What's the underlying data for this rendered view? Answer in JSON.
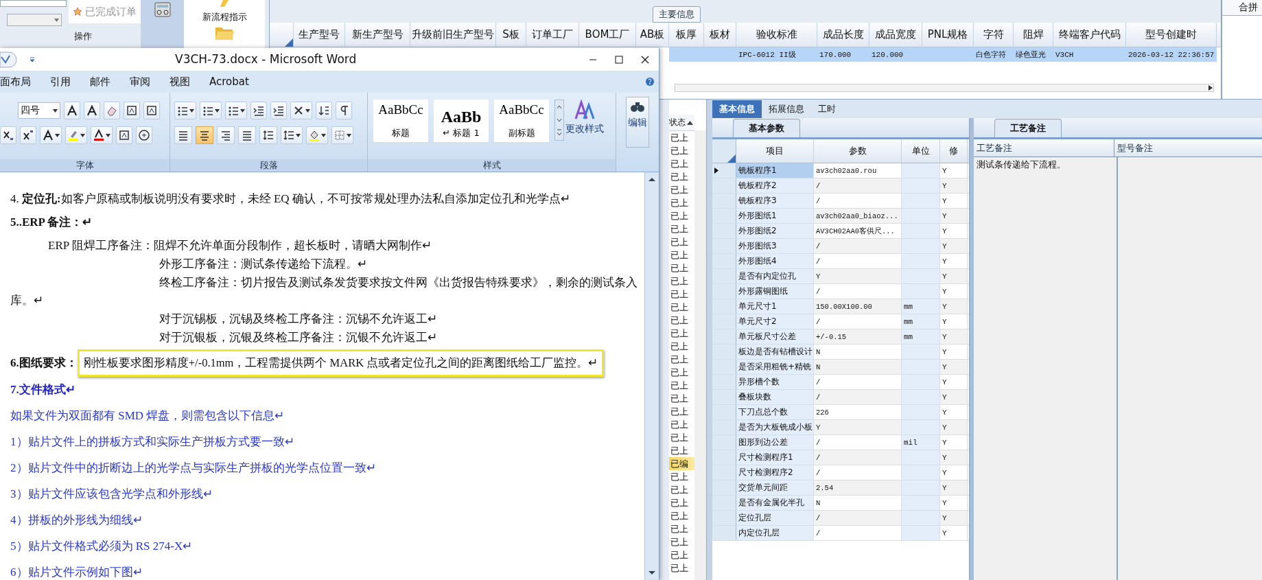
{
  "erp": {
    "left_tab": "已完成订单",
    "operations_label": "操作",
    "toolbar_button": "新流程指示",
    "main_grid": {
      "group_label": "主要信息",
      "columns": [
        "生产型号",
        "新生产型号",
        "升级前旧生产型号",
        "S板",
        "订单工厂",
        "BOM工厂",
        "AB板",
        "板厚",
        "板材",
        "验收标准",
        "成品长度",
        "成品宽度",
        "PNL规格",
        "字符",
        "阻焊",
        "终端客户代码",
        "型号创建时"
      ],
      "rows": [
        {
          "selected": true,
          "cells": [
            null,
            null,
            null,
            null,
            null,
            null,
            null,
            null,
            null,
            "IPC-6012 II级",
            "170.000",
            "120.000",
            null,
            "白色字符",
            "绿色亚光",
            "V3CH",
            "2026-03-12 22:36:57"
          ]
        }
      ]
    },
    "merge_panel": {
      "title": "合拼"
    },
    "status_list": {
      "header": "状态",
      "rows": [
        {
          "text": "已上",
          "selected": false
        },
        {
          "text": "已上",
          "selected": false
        },
        {
          "text": "已上",
          "selected": false
        },
        {
          "text": "已上",
          "selected": false
        },
        {
          "text": "已上",
          "selected": false
        },
        {
          "text": "已上",
          "selected": false
        },
        {
          "text": "已上",
          "selected": false
        },
        {
          "text": "已上",
          "selected": false
        },
        {
          "text": "已上",
          "selected": false
        },
        {
          "text": "已上",
          "selected": false
        },
        {
          "text": "已上",
          "selected": false
        },
        {
          "text": "已上",
          "selected": false
        },
        {
          "text": "已上",
          "selected": false
        },
        {
          "text": "已上",
          "selected": false
        },
        {
          "text": "已上",
          "selected": false
        },
        {
          "text": "已上",
          "selected": false
        },
        {
          "text": "已上",
          "selected": false
        },
        {
          "text": "已上",
          "selected": false
        },
        {
          "text": "已上",
          "selected": false
        },
        {
          "text": "已上",
          "selected": false
        },
        {
          "text": "已上",
          "selected": false
        },
        {
          "text": "已上",
          "selected": false
        },
        {
          "text": "已上",
          "selected": false
        },
        {
          "text": "已上",
          "selected": false
        },
        {
          "text": "已上",
          "selected": false
        },
        {
          "text": "已编",
          "selected": true
        },
        {
          "text": "已上",
          "selected": false
        },
        {
          "text": "已上",
          "selected": false
        },
        {
          "text": "已上",
          "selected": false
        },
        {
          "text": "已上",
          "selected": false
        },
        {
          "text": "已上",
          "selected": false
        },
        {
          "text": "已上",
          "selected": false
        },
        {
          "text": "已上",
          "selected": false
        },
        {
          "text": "已上",
          "selected": false
        }
      ]
    },
    "detail_tabs": [
      {
        "label": "基本信息",
        "selected": true
      },
      {
        "label": "拓展信息",
        "selected": false
      },
      {
        "label": "工时",
        "selected": false
      }
    ],
    "params_panel": {
      "tab": "基本参数",
      "columns": [
        "项目",
        "参数",
        "单位",
        "修"
      ],
      "rows": [
        {
          "item": "铣板程序1",
          "value": "av3ch02aa0.rou",
          "modified": "Y",
          "selected": true
        },
        {
          "item": "铣板程序2",
          "value": "/",
          "modified": "Y",
          "selected": false
        },
        {
          "item": "铣板程序3",
          "value": "/",
          "modified": "Y",
          "selected": false
        },
        {
          "item": "外形图纸1",
          "value": "av3ch02aa0_biaoz...",
          "modified": "Y",
          "selected": false
        },
        {
          "item": "外形图纸2",
          "value": "AV3CH02AA0客供尺...",
          "modified": "Y",
          "selected": false
        },
        {
          "item": "外形图纸3",
          "value": "/",
          "modified": "Y",
          "selected": false
        },
        {
          "item": "外形图纸4",
          "value": "/",
          "modified": "Y",
          "selected": false
        },
        {
          "item": "是否有内定位孔",
          "value": "Y",
          "modified": "Y",
          "selected": false
        },
        {
          "item": "外形露铜图纸",
          "value": "/",
          "modified": "Y",
          "selected": false
        },
        {
          "item": "单元尺寸1",
          "value": "150.00X100.00",
          "unit": "mm",
          "modified": "Y",
          "selected": false
        },
        {
          "item": "单元尺寸2",
          "value": "/",
          "unit": "mm",
          "modified": "Y",
          "selected": false
        },
        {
          "item": "单元板尺寸公差",
          "value": "+/-0.15",
          "unit": "mm",
          "modified": "Y",
          "selected": false
        },
        {
          "item": "板边是否有钻槽设计",
          "value": "N",
          "modified": "Y",
          "selected": false
        },
        {
          "item": "是否采用粗铣+精铣",
          "value": "N",
          "modified": "Y",
          "selected": false
        },
        {
          "item": "异形槽个数",
          "value": "/",
          "modified": "Y",
          "selected": false
        },
        {
          "item": "叠板块数",
          "value": "/",
          "modified": "Y",
          "selected": false
        },
        {
          "item": "下刀点总个数",
          "value": "226",
          "modified": "Y",
          "selected": false
        },
        {
          "item": "是否为大板铣成小板",
          "value": "Y",
          "modified": "Y",
          "selected": false
        },
        {
          "item": "图形到边公差",
          "value": "/",
          "unit": "mil",
          "modified": "Y",
          "selected": false
        },
        {
          "item": "尺寸检测程序1",
          "value": "/",
          "modified": "Y",
          "selected": false
        },
        {
          "item": "尺寸检测程序2",
          "value": "/",
          "modified": "Y",
          "selected": false
        },
        {
          "item": "交货单元间距",
          "value": "2.54",
          "modified": "Y",
          "selected": false
        },
        {
          "item": "是否有金属化半孔",
          "value": "N",
          "modified": "Y",
          "selected": false
        },
        {
          "item": "定位孔层",
          "value": "/",
          "modified": "Y",
          "selected": false
        },
        {
          "item": "内定位孔层",
          "value": "/",
          "modified": "Y",
          "selected": false
        }
      ]
    },
    "notes_panel": {
      "tab": "工艺备注",
      "columns": [
        "工艺备注",
        "型号备注"
      ],
      "process_note": "测试条传递给下流程。"
    }
  },
  "word": {
    "title": "V3CH-73.docx - Microsoft Word",
    "ribbon_tabs": [
      "面布局",
      "引用",
      "邮件",
      "审阅",
      "视图",
      "Acrobat"
    ],
    "font_size": "四号",
    "align_buttons": [
      {
        "selected": false
      },
      {
        "selected": true
      },
      {
        "selected": false
      },
      {
        "selected": false
      },
      {
        "selected": false
      }
    ],
    "groups": [
      "字体",
      "段落",
      "样式"
    ],
    "styles": [
      {
        "kind": "title",
        "sample": "AaBbCc",
        "label": "标题"
      },
      {
        "kind": "heading",
        "sample": "AaBb",
        "label": "↵ 标题 1"
      },
      {
        "kind": "subtitle",
        "sample": "AaBbCc",
        "label": "副标题"
      }
    ],
    "change_styles": "更改样式",
    "edit": "编辑",
    "paragraphs": [
      {
        "kind": "body",
        "text": "4.  **定位孔:**如客户原稿或制板说明没有要求时，未经 EQ 确认，不可按常规处理办法私自添加定位孔和光学点↵"
      },
      {
        "kind": "heading",
        "text": "5..ERP 备注：↵"
      },
      {
        "kind": "indent",
        "text": "ERP 阻焊工序备注：阻焊不允许单面分段制作，超长板时，请晒大网制作↵"
      },
      {
        "kind": "deep",
        "text": "外形工序备注：测试条传递给下流程。↵"
      },
      {
        "kind": "deep",
        "text": "终检工序备注：切片报告及测试条发货要求按文件网《出货报告特殊要求》，剩余的测试条入库。↵"
      },
      {
        "kind": "deep",
        "text": "对于沉锡板，沉锡及终检工序备注：沉锡不允许返工↵"
      },
      {
        "kind": "deep",
        "text": "对于沉银板，沉银及终检工序备注：沉银不允许返工↵"
      },
      {
        "kind": "highlighted",
        "label": "6.图纸要求：",
        "text": "刚性板要求图形精度+/-0.1mm，工程需提供两个 MARK 点或者定位孔之间的距离图纸给工厂监控。↵"
      },
      {
        "kind": "blue-heading",
        "text": "7.文件格式↵"
      },
      {
        "kind": "blue",
        "text": "如果文件为双面都有 SMD 焊盘，则需包含以下信息↵"
      },
      {
        "kind": "blue",
        "text": "1）贴片文件上的拼板方式和实际生产拼板方式要一致↵"
      },
      {
        "kind": "blue",
        "text": "2）贴片文件中的折断边上的光学点与实际生产拼板的光学点位置一致↵"
      },
      {
        "kind": "blue",
        "text": "3）贴片文件应该包含光学点和外形线↵"
      },
      {
        "kind": "blue",
        "text": "4）拼板的外形线为细线↵"
      },
      {
        "kind": "blue",
        "text": "5）贴片文件格式必须为 RS 274-X↵"
      },
      {
        "kind": "blue",
        "text": "6）贴片文件示例如下图↵"
      }
    ]
  }
}
